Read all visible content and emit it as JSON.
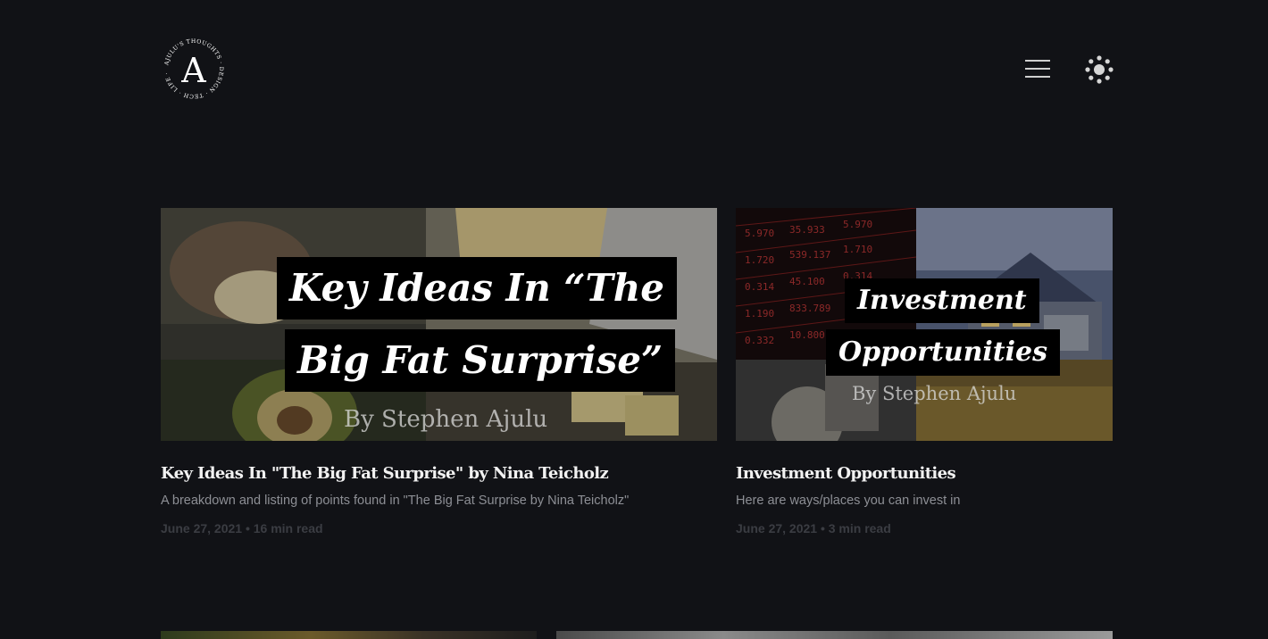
{
  "header": {
    "logo_letter": "A",
    "logo_ring_text": "AJULU'S THOUGHTS · DESIGN · TECH · LIFE · MORE ·",
    "menu_icon": "hamburger-menu-icon",
    "theme_icon": "sun-theme-icon"
  },
  "posts": [
    {
      "thumb": {
        "line1": "Key Ideas In “The",
        "line2": "Big Fat Surprise”",
        "byline": "By Stephen Ajulu"
      },
      "title": "Key Ideas In \"The Big Fat Surprise\" by Nina Teicholz",
      "excerpt": "A breakdown and listing of points found in \"The Big Fat Surprise by Nina Teicholz\"",
      "meta": "June 27, 2021 • 16 min read"
    },
    {
      "thumb": {
        "line1": "Investment",
        "line2": "Opportunities",
        "byline": "By Stephen Ajulu"
      },
      "title": "Investment Opportunities",
      "excerpt": "Here are ways/places you can invest in",
      "meta": "June 27, 2021 • 3 min read"
    }
  ],
  "colors": {
    "background": "#111216",
    "title": "#f2f2f2",
    "excerpt": "#8d8f95",
    "meta": "#3b3d43"
  }
}
